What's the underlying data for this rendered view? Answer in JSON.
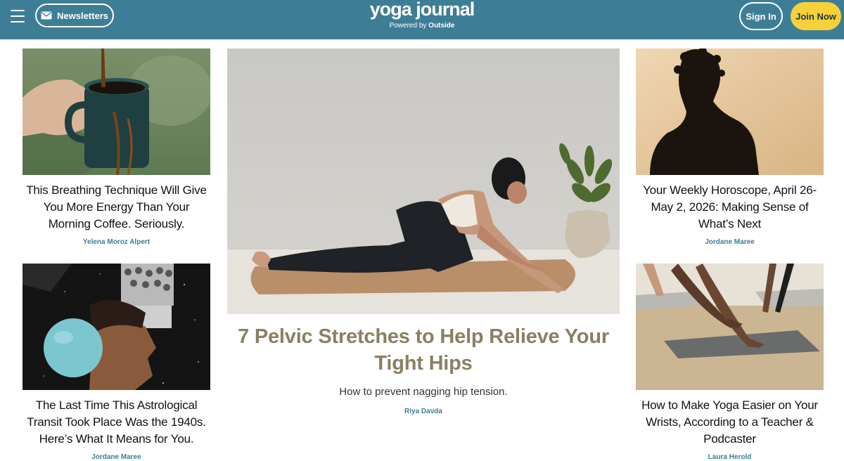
{
  "header": {
    "newsletters_label": "Newsletters",
    "logo_main": "yoga journal",
    "logo_sub_prefix": "Powered by",
    "logo_sub_brand": "Outside",
    "signin_label": "Sign In",
    "join_label": "Join Now"
  },
  "colors": {
    "header_bg": "#3d7e96",
    "join_bg": "#f8d13a",
    "author": "#3d7e96",
    "feature_title": "#8a8060"
  },
  "articles": {
    "left_1": {
      "title": "This Breathing Technique Will Give You More Energy Than Your Morning Coffee. Seriously.",
      "author": "Yelena Moroz Alpert",
      "image": "coffee-mug-image"
    },
    "left_2": {
      "title": "The Last Time This Astrological Transit Took Place Was the 1940s. Here’s What It Means for You.",
      "author": "Jordane Maree",
      "image": "astrology-collage-image"
    },
    "feature": {
      "title": "7 Pelvic Stretches to Help Relieve Your Tight Hips",
      "dek": "How to prevent nagging hip tension.",
      "author": "Riya Davda",
      "image": "pigeon-pose-image"
    },
    "right_1": {
      "title": "Your Weekly Horoscope, April 26-May 2, 2026: Making Sense of What’s Next",
      "author": "Jordane Maree",
      "image": "silhouette-image"
    },
    "right_2": {
      "title": "How to Make Yoga Easier on Your Wrists, According to a Teacher & Podcaster",
      "author": "Laura Herold",
      "image": "downward-dog-image"
    }
  }
}
